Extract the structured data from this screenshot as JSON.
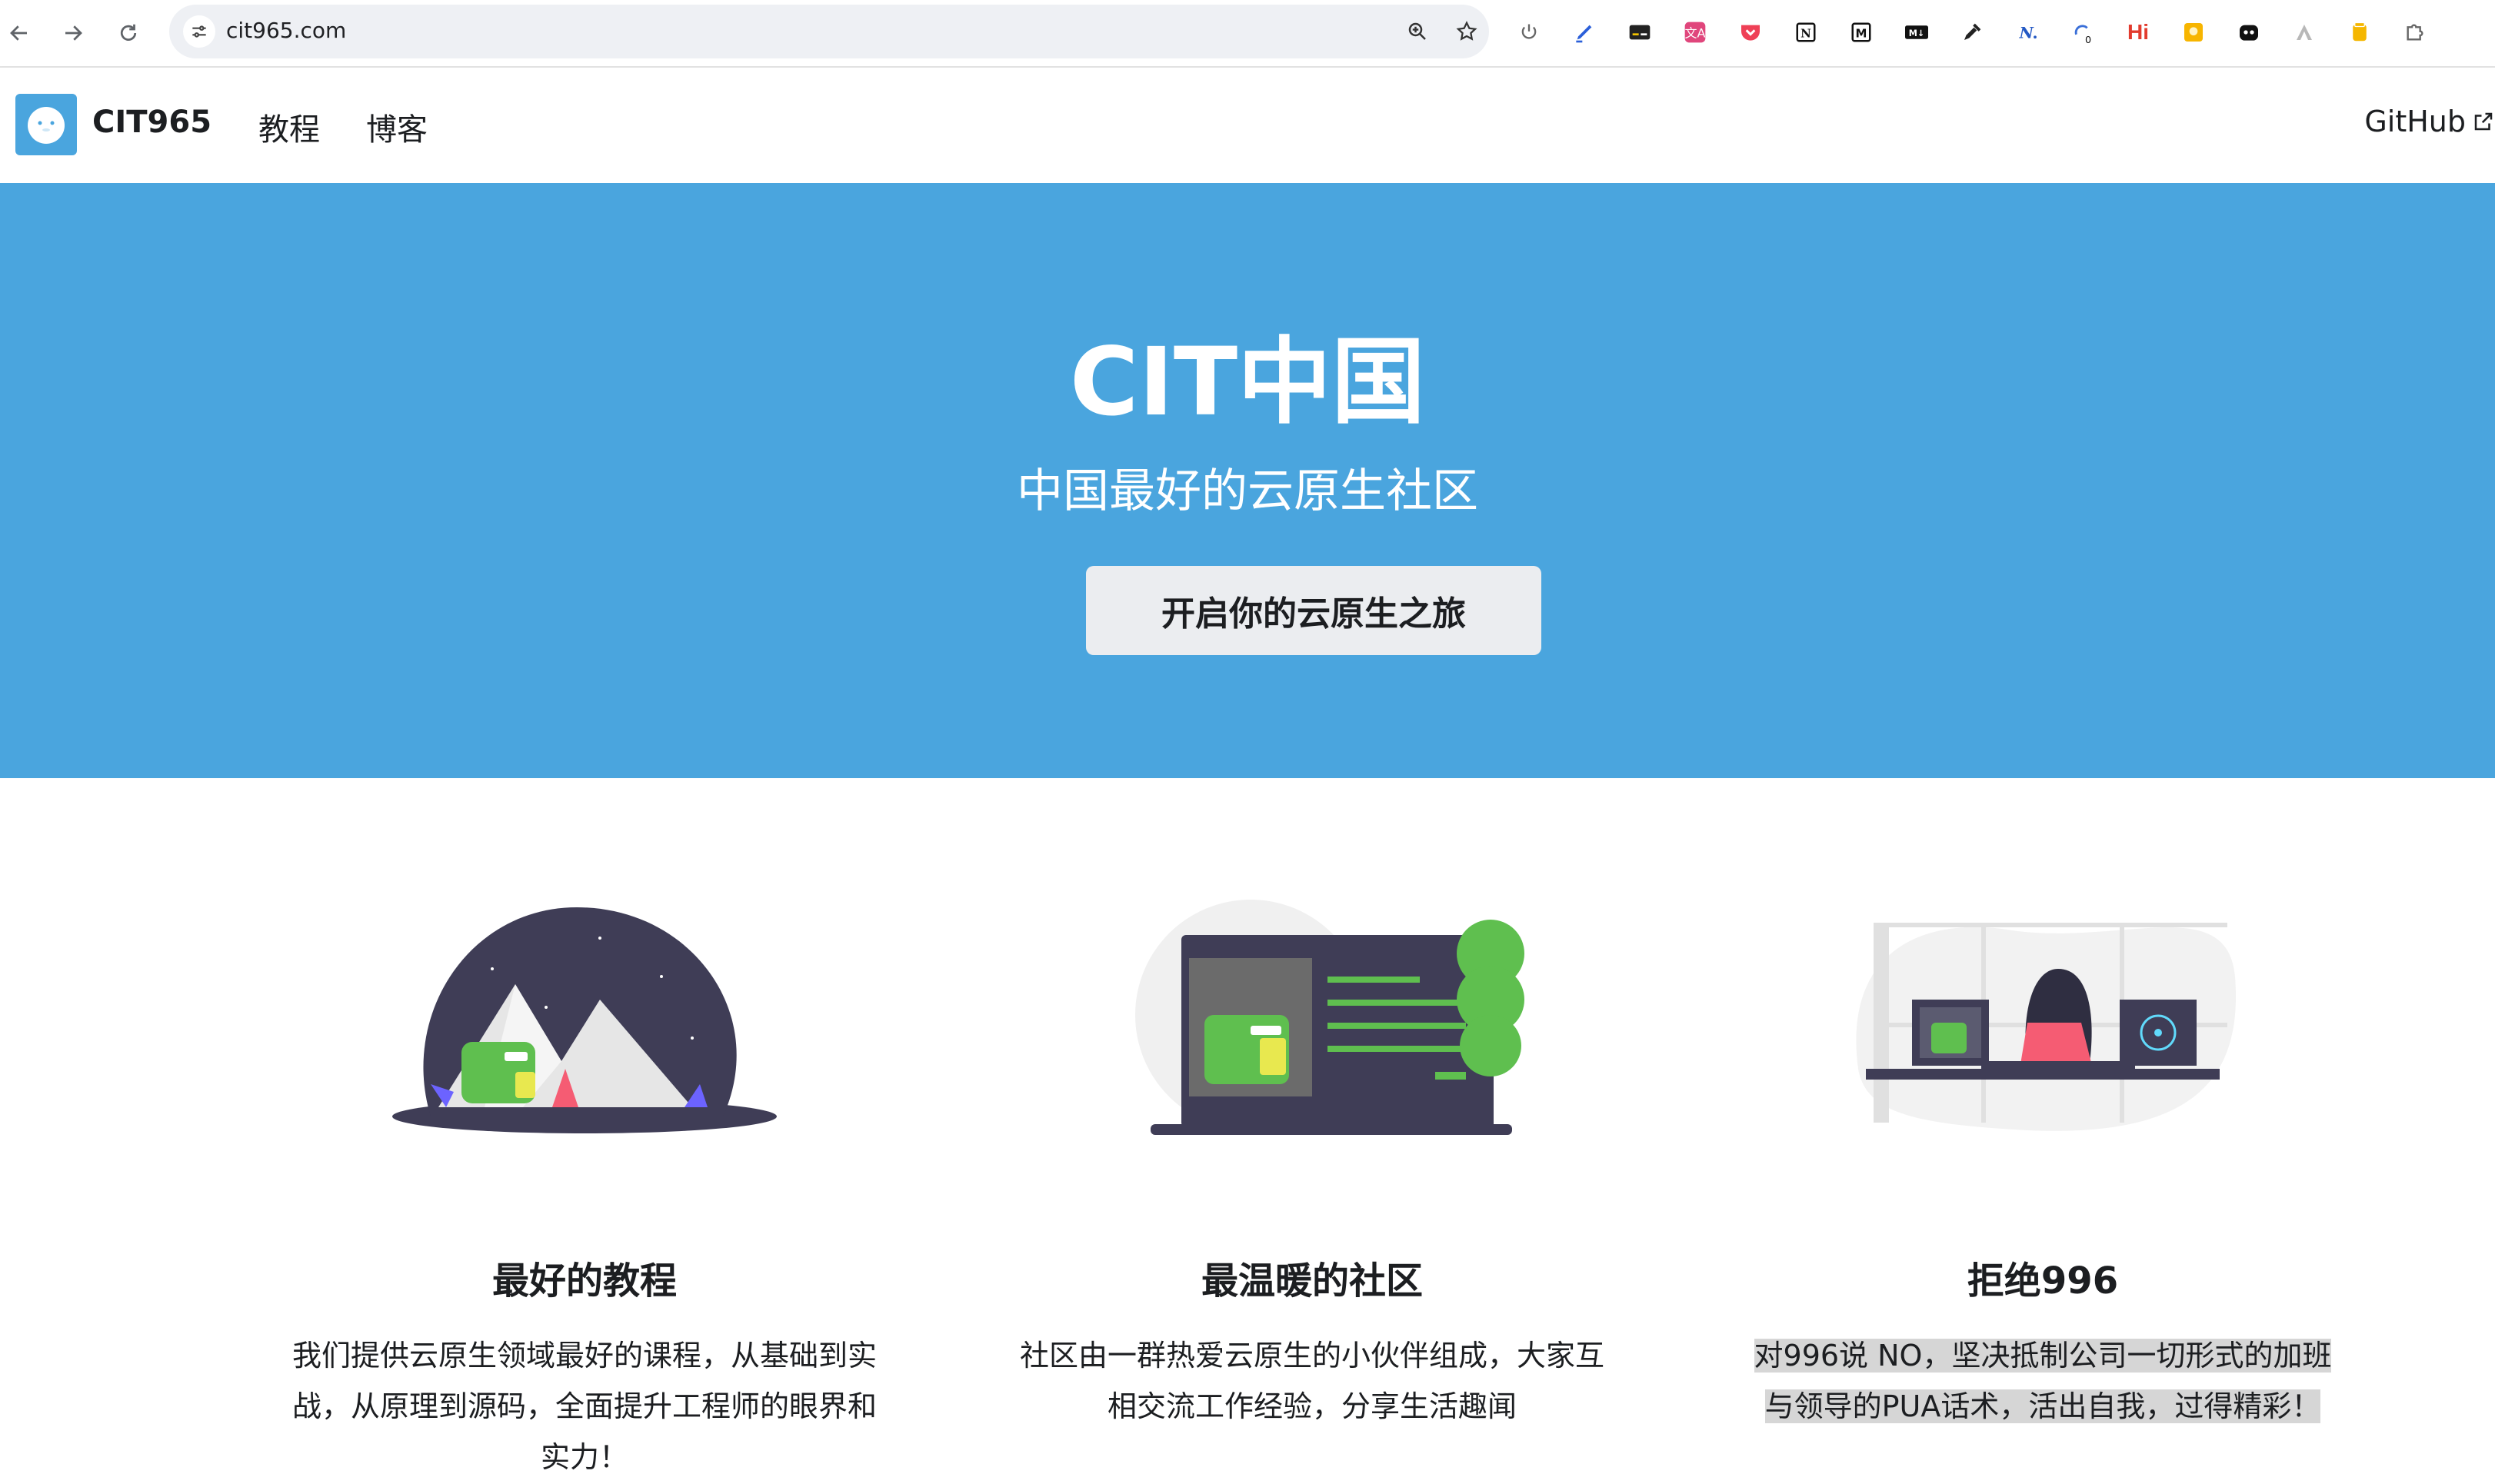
{
  "browser": {
    "url": "cit965.com",
    "extensions": [
      "power-icon",
      "highlighter-icon",
      "subtitles-icon",
      "translate-icon",
      "pocket-icon",
      "notion-icon",
      "medium-icon",
      "markdown-icon",
      "eyedropper-icon",
      "n-icon",
      "sync-icon",
      "hi-icon",
      "sticky-note-icon",
      "ghost-icon",
      "triangle-icon",
      "jar-icon",
      "puzzle-icon"
    ],
    "sync_badge": "0",
    "hi_label": "Hi"
  },
  "navbar": {
    "brand": "CIT965",
    "links": [
      "教程",
      "博客"
    ],
    "github": "GitHub"
  },
  "hero": {
    "title": "CIT中国",
    "subtitle": "中国最好的云原生社区",
    "cta": "开启你的云原生之旅"
  },
  "features": [
    {
      "title": "最好的教程",
      "description": "我们提供云原生领域最好的课程，从基础到实战，从原理到源码，全面提升工程师的眼界和实力！"
    },
    {
      "title": "最温暖的社区",
      "description": "社区由一群热爱云原生的小伙伴组成，大家互相交流工作经验，分享生活趣闻"
    },
    {
      "title": "拒绝996",
      "description": "对996说 NO，坚决抵制公司一切形式的加班与领导的PUA话术，活出自我，过得精彩！"
    }
  ],
  "colors": {
    "hero_bg": "#4aa5de",
    "button_bg": "#ebedf0",
    "dino_green": "#5fbf4f"
  }
}
